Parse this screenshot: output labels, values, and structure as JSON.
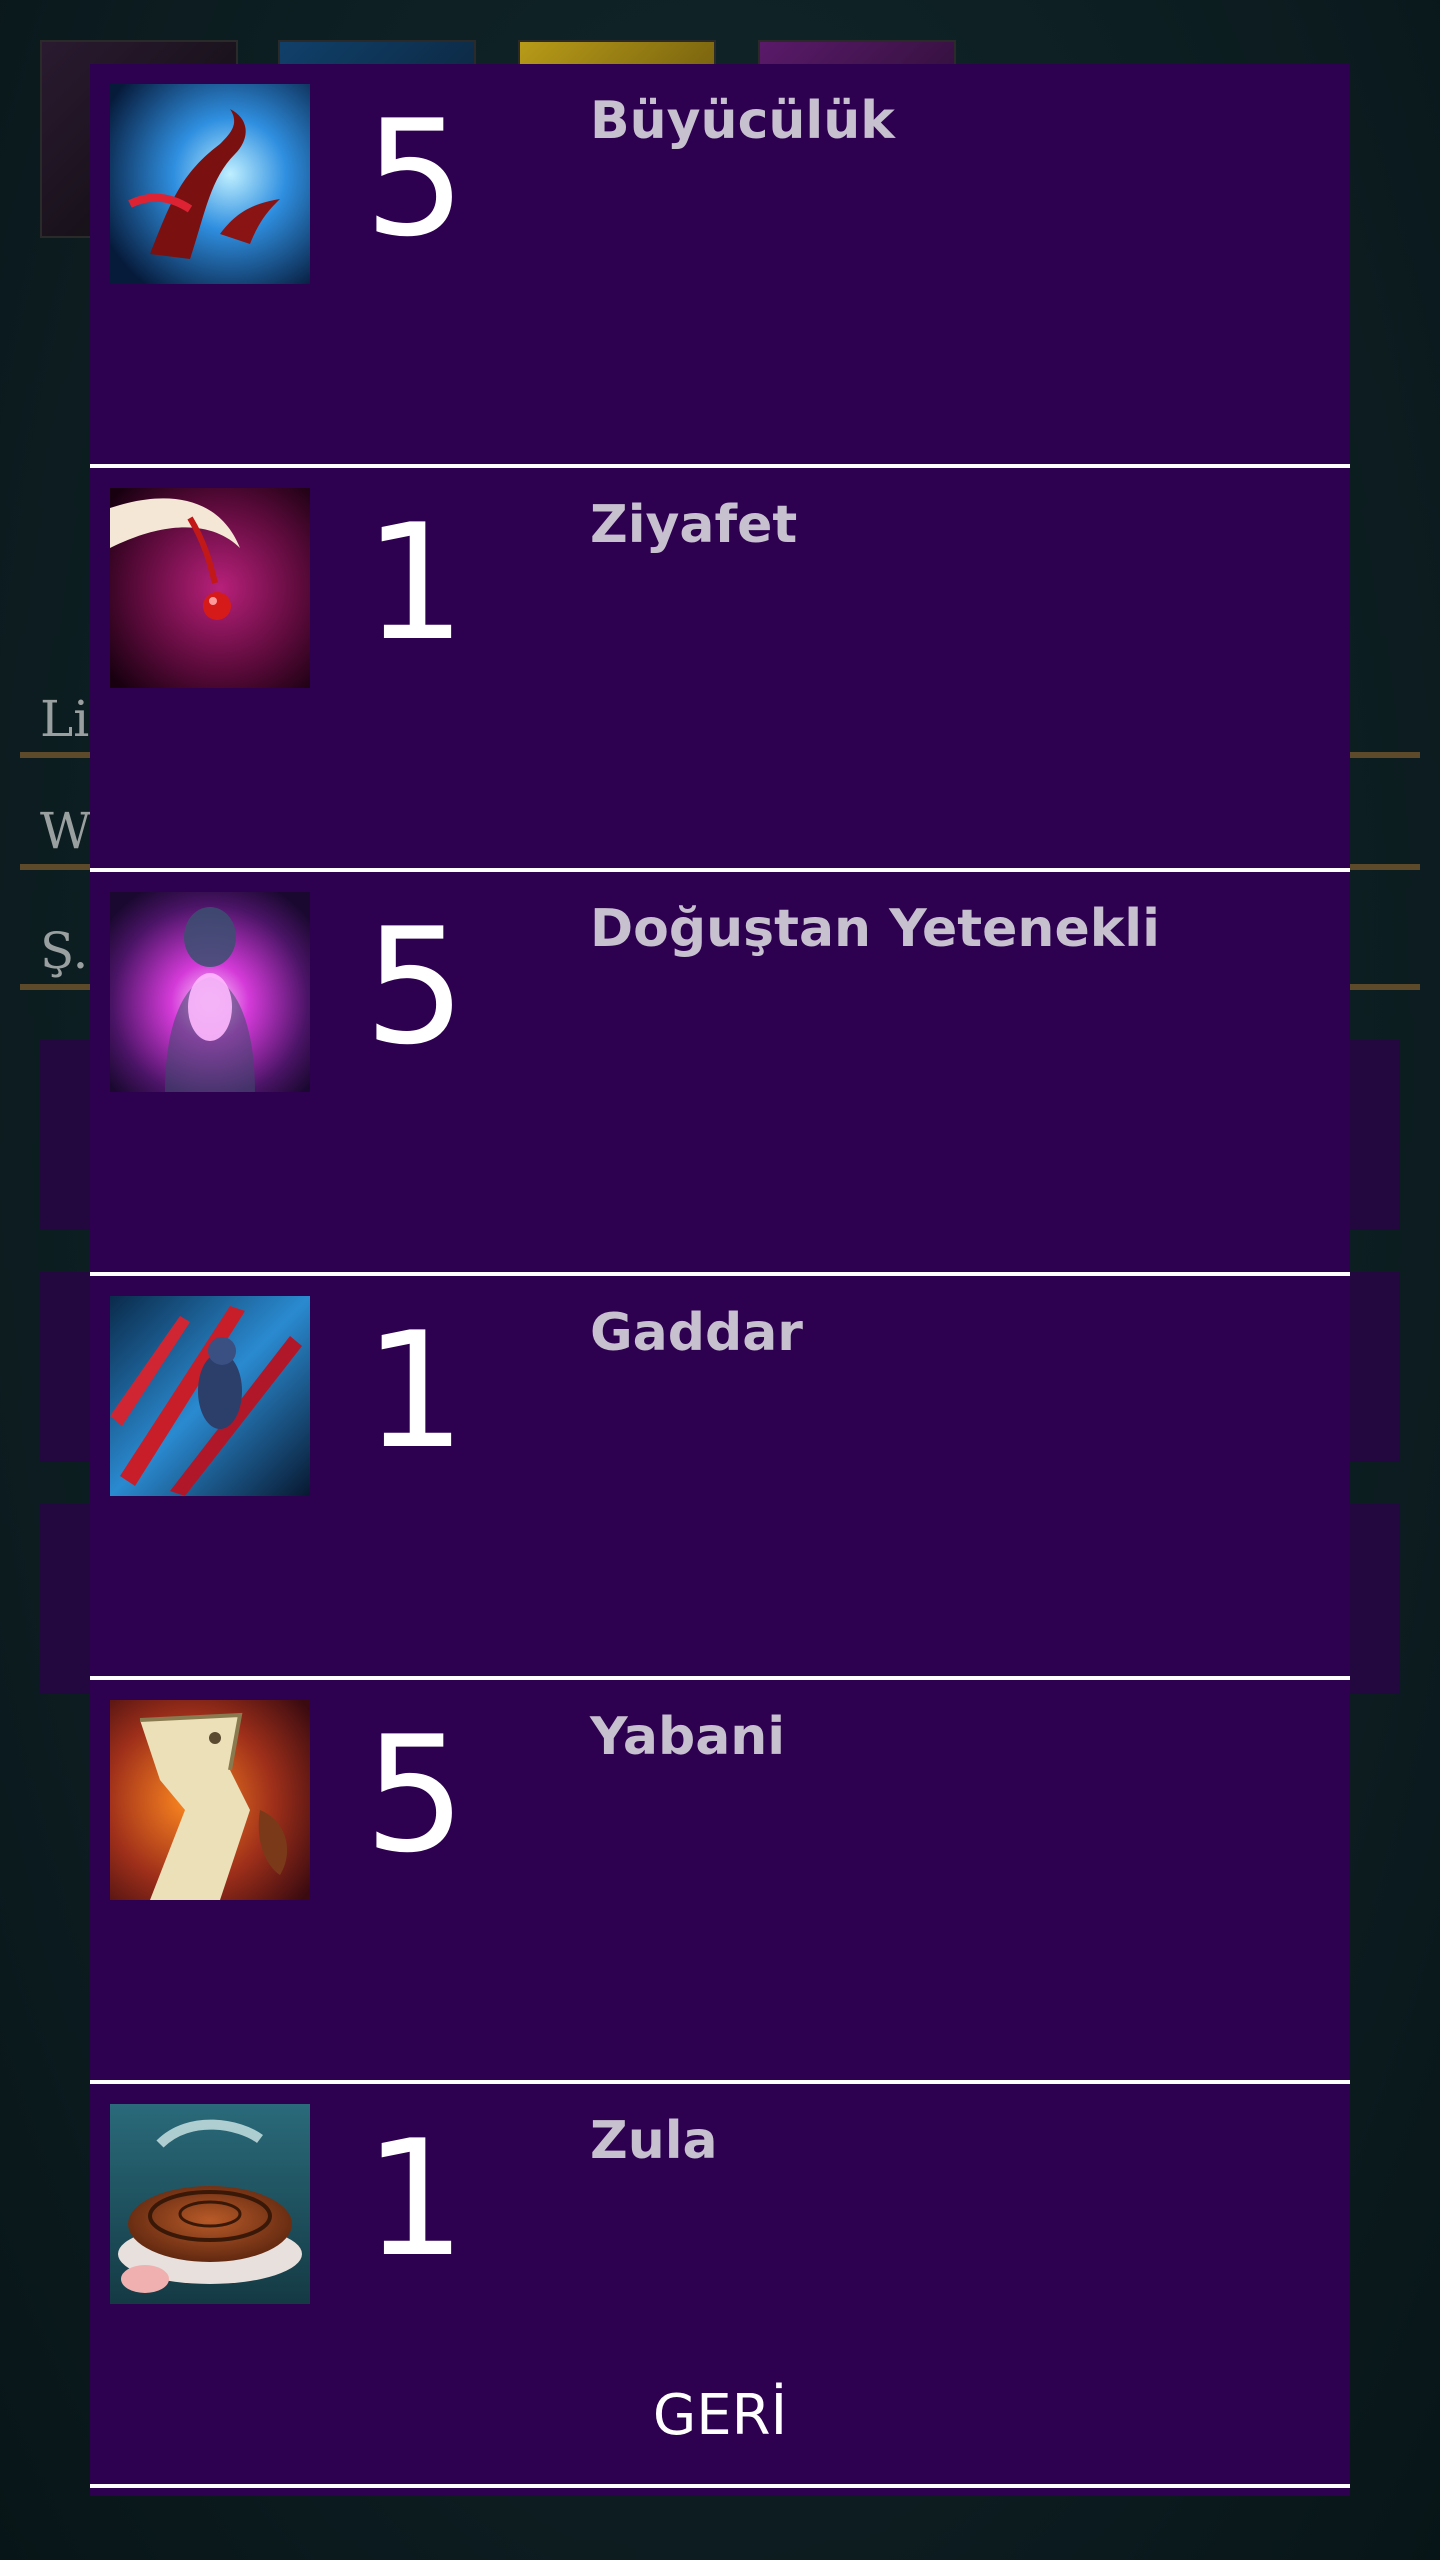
{
  "background_page": {
    "fields": [
      {
        "text": "Li"
      },
      {
        "text": "W"
      },
      {
        "text": "Ş."
      }
    ]
  },
  "dialog": {
    "traits": [
      {
        "count": "5",
        "name": "Büyücülük",
        "icon": "sorcery-icon"
      },
      {
        "count": "1",
        "name": "Ziyafet",
        "icon": "feast-icon"
      },
      {
        "count": "5",
        "name": "Doğuştan Yetenekli",
        "icon": "innate-talent-icon"
      },
      {
        "count": "1",
        "name": "Gaddar",
        "icon": "brutal-icon"
      },
      {
        "count": "5",
        "name": "Yabani",
        "icon": "savage-icon"
      },
      {
        "count": "1",
        "name": "Zula",
        "icon": "stash-icon"
      }
    ],
    "back_label": "GERİ"
  },
  "colors": {
    "dialog_background": "#2d0050",
    "divider": "#ffffff",
    "count_text": "#ffffff",
    "name_text": "#c7c0cf"
  }
}
